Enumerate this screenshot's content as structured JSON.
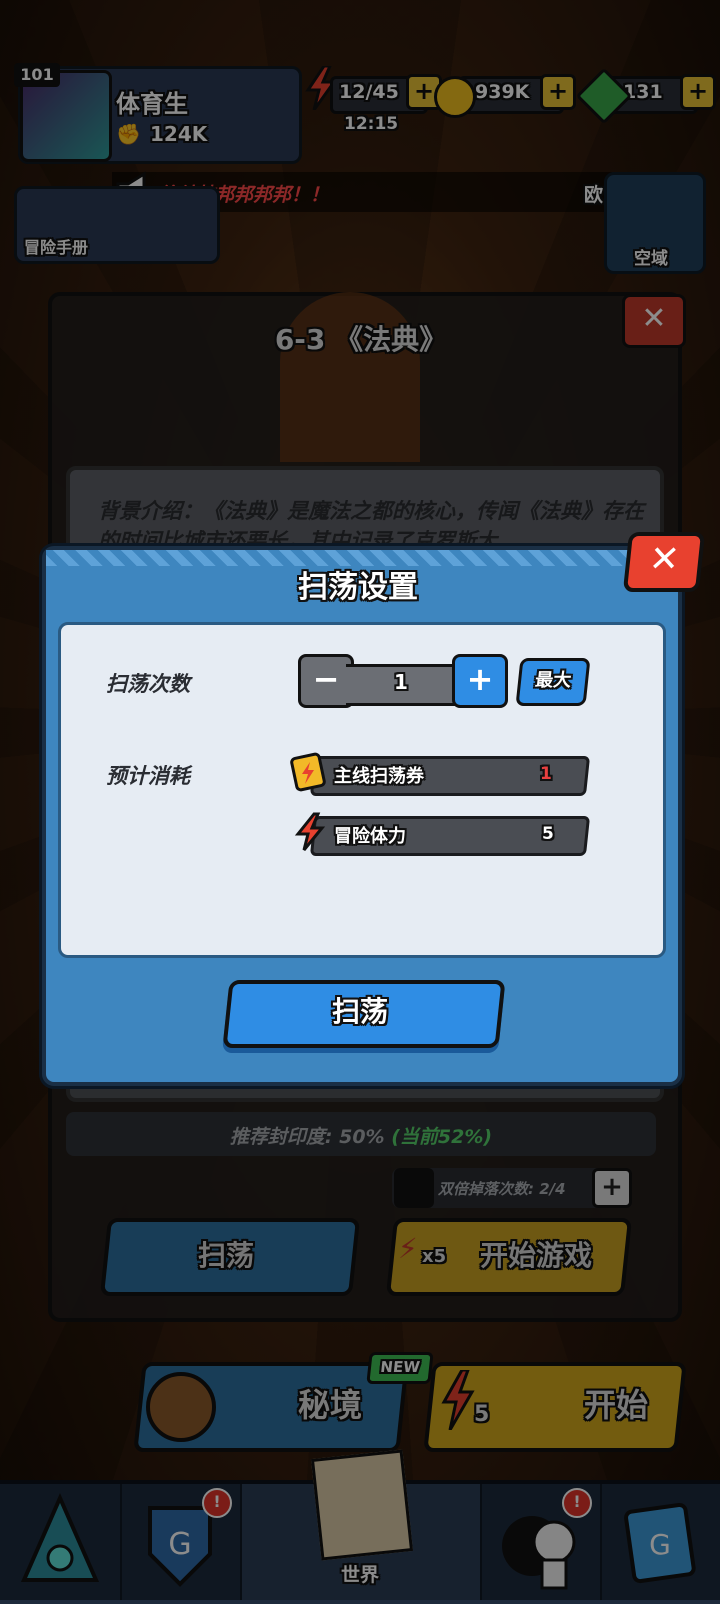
{
  "player": {
    "level": "101",
    "name": "体育生",
    "power": "124K"
  },
  "resources": {
    "energy": "12/45",
    "energy_timer": "12:15",
    "coins": "939K",
    "gems": "131"
  },
  "marquee": {
    "text": "终结技邦邦邦邦！！",
    "tail": "欧"
  },
  "side_buttons": {
    "handbook": "冒险手册",
    "skyzone": "空域"
  },
  "stage": {
    "title": "6-3 《法典》",
    "description": "背景介绍：《法典》是魔法之都的核心，传闻《法典》存在的时间比城市还要长，其中记录了克罗斯大",
    "seal_text": "推荐封印度: 50%",
    "seal_current": "(当前52%)",
    "double_drop": "双倍掉落次数: 2/4",
    "sweep_label": "扫荡",
    "start_cost": "x5",
    "start_label": "开始游戏"
  },
  "modal": {
    "title": "扫荡设置",
    "count_label": "扫荡次数",
    "count_value": "1",
    "max_label": "最大",
    "cost_label": "预计消耗",
    "costs": [
      {
        "name": "主线扫荡券",
        "value": "1",
        "icon": "ticket-icon",
        "value_color": "#e84040"
      },
      {
        "name": "冒险体力",
        "value": "5",
        "icon": "energy-bolt-icon",
        "value_color": "#ffffff"
      }
    ],
    "sweep_button": "扫荡"
  },
  "world_buttons": {
    "secret_label": "秘境",
    "new_badge": "NEW",
    "start_cost": "5",
    "start_label": "开始"
  },
  "bottom_nav": {
    "items": [
      {
        "name": "hero",
        "icon": "crystal-icon"
      },
      {
        "name": "guild",
        "icon": "shield-icon",
        "badge": "!"
      },
      {
        "name": "world",
        "label": "世界",
        "icon": "map-icon"
      },
      {
        "name": "character",
        "icon": "character-icon",
        "badge": "!"
      },
      {
        "name": "shop",
        "icon": "card-icon"
      }
    ]
  },
  "colors": {
    "accent_blue": "#2f8de4",
    "modal_blue": "#3e86bf",
    "gold": "#d2a81d",
    "alert_red": "#e8412f"
  }
}
